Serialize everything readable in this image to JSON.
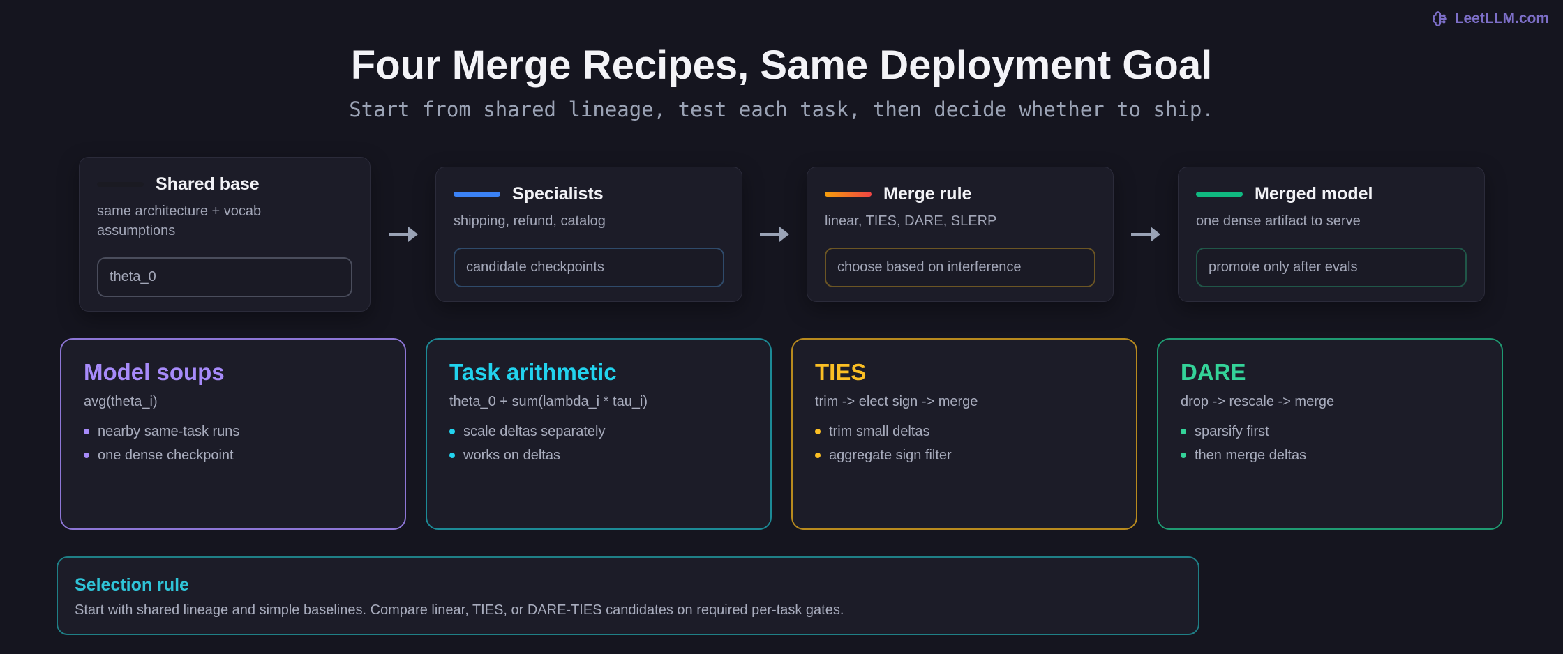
{
  "brand": {
    "label": "LeetLLM.com",
    "icon": "brain-icon",
    "color": "#7d6fc8"
  },
  "header": {
    "title": "Four Merge Recipes, Same Deployment Goal",
    "subtitle": "Start from shared lineage, test each task, then decide whether to ship."
  },
  "pipeline": [
    {
      "title": "Shared base",
      "desc": "same architecture + vocab assumptions",
      "pill": "theta_0",
      "bar": "#1a1a22",
      "pill_border": "#4a4d5c"
    },
    {
      "title": "Specialists",
      "desc": "shipping, refund, catalog",
      "pill": "candidate checkpoints",
      "bar": "#3b82f6",
      "pill_border": "#2f4a6a"
    },
    {
      "title": "Merge rule",
      "desc": "linear, TIES, DARE, SLERP",
      "pill": "choose based on interference",
      "bar": "#f26b1d",
      "pill_border": "#6b5524"
    },
    {
      "title": "Merged model",
      "desc": "one dense artifact to serve",
      "pill": "promote only after evals",
      "bar": "#10b981",
      "pill_border": "#205648"
    }
  ],
  "recipes": [
    {
      "title": "Model soups",
      "formula": "avg(theta_i)",
      "items": [
        "nearby same-task runs",
        "one dense checkpoint"
      ],
      "color": "#a78bfa",
      "border": "#8d76d6"
    },
    {
      "title": "Task arithmetic",
      "formula": "theta_0 + sum(lambda_i * tau_i)",
      "items": [
        "scale deltas separately",
        "works on deltas"
      ],
      "color": "#22d3ee",
      "border": "#1c8a96"
    },
    {
      "title": "TIES",
      "formula": "trim -> elect sign -> merge",
      "items": [
        "trim small deltas",
        "aggregate sign filter"
      ],
      "color": "#fbbf24",
      "border": "#b88a1e"
    },
    {
      "title": "DARE",
      "formula": "drop -> rescale -> merge",
      "items": [
        "sparsify first",
        "then merge deltas"
      ],
      "color": "#34d399",
      "border": "#1f9a72"
    }
  ],
  "selection": {
    "title": "Selection rule",
    "text": "Start with shared lineage and simple baselines. Compare linear, TIES, or DARE-TIES candidates on required per-task gates."
  }
}
